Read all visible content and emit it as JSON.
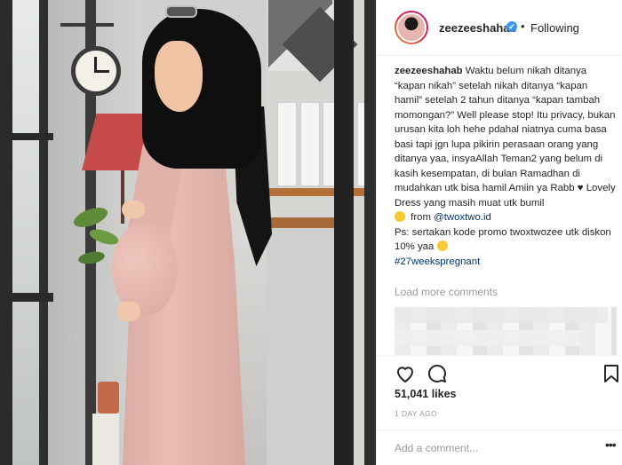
{
  "post": {
    "username": "zeezeeshahab",
    "follow_state": "Following",
    "separator": "•",
    "verified_mark": "✔"
  },
  "caption": {
    "username": "zeezeeshahab",
    "text_1": " Waktu belum nikah ditanya “kapan nikah” setelah nikah ditanya “kapan hamil” setelah 2 tahun ditanya “kapan tambah momongan?” Well please stop! Itu privacy, bukan urusan kita loh hehe pdahal niatnya cuma basa basi tapi jgn lupa pikirin perasaan orang yang ditanya yaa, insyaAllah Teman2 yang belum di kasih kesempatan, di bulan Ramadhan di mudahkan utk bisa hamil Amiin ya Rabb ",
    "heart": "♥",
    "text_2": " Lovely Dress yang masih muat utk bumil",
    "from_text": " from ",
    "mention": "@twoxtwo.id",
    "text_3": "Ps: sertakan kode promo twoxtwozee utk diskon 10% yaa",
    "hashtag": "#27weekspregnant"
  },
  "comments": {
    "load_more_label": "Load more comments"
  },
  "engagement": {
    "likes": "51,041 likes",
    "timestamp": "1 DAY AGO"
  },
  "comment_box": {
    "placeholder": "Add a comment...",
    "more_label": "•••"
  },
  "icons": {
    "like": "heart-outline-icon",
    "comment": "speech-bubble-icon",
    "save": "bookmark-icon",
    "more": "more-options-icon"
  },
  "colors": {
    "link": "#003569",
    "verified": "#3897f0",
    "muted": "#999999",
    "text": "#262626",
    "dress": "#e3b4ab",
    "hijab": "#0f0f10"
  }
}
